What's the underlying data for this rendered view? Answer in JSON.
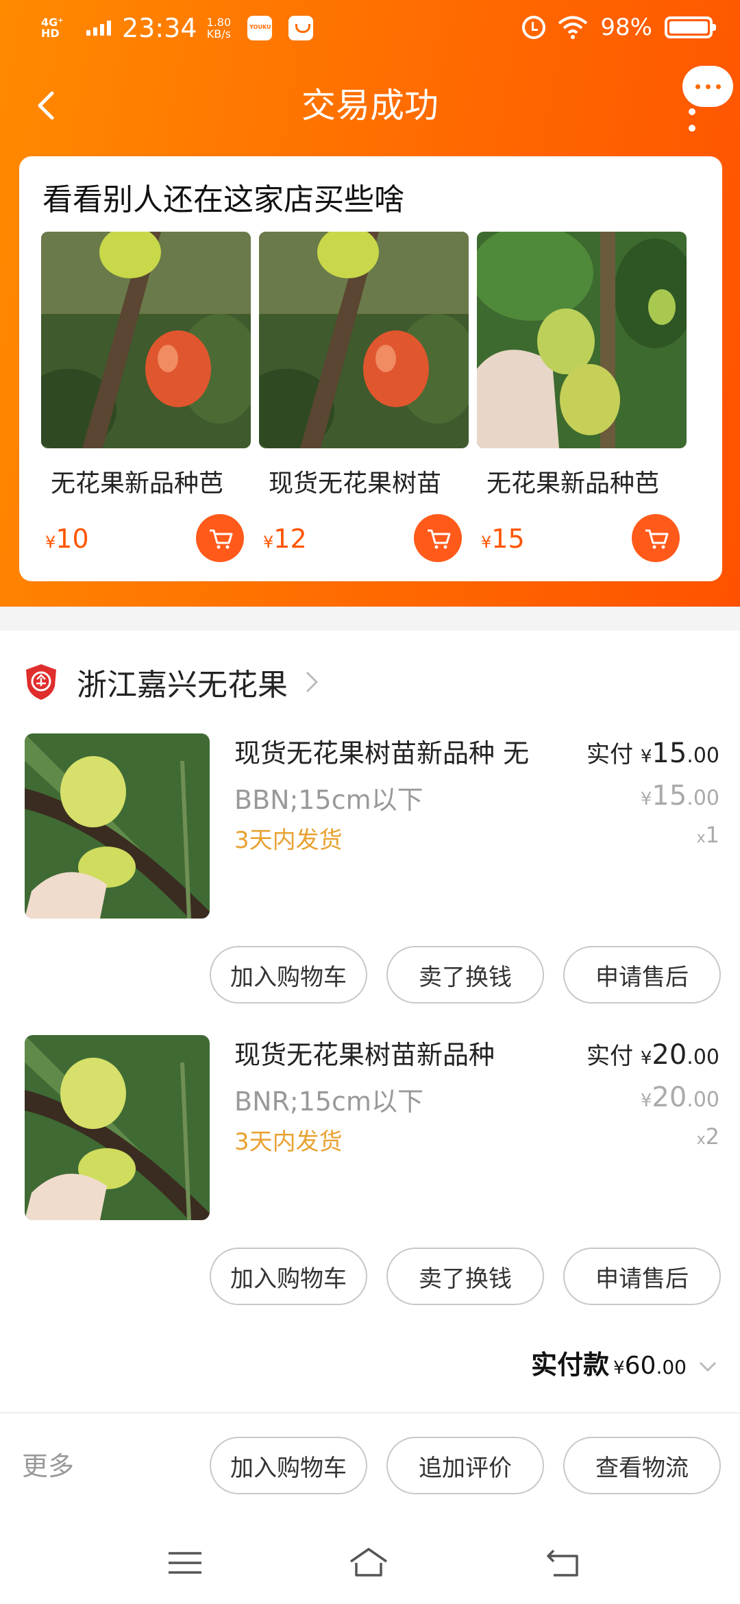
{
  "status_bar": {
    "network": "4G⁺ HD",
    "time": "23:34",
    "speed_value": "1.80",
    "speed_unit": "KB/s",
    "battery": "98%"
  },
  "header": {
    "title": "交易成功"
  },
  "recommend": {
    "title": "看看别人还在这家店买些啥",
    "items": [
      {
        "name": "无花果新品种芭",
        "currency": "¥",
        "price": "10"
      },
      {
        "name": "现货无花果树苗",
        "currency": "¥",
        "price": "12"
      },
      {
        "name": "无花果新品种芭",
        "currency": "¥",
        "price": "15"
      }
    ]
  },
  "shop": {
    "name": "浙江嘉兴无花果"
  },
  "order_items": [
    {
      "title": "现货无花果树苗新品种 无",
      "sku": "BBN;15cm以下",
      "shipping": "3天内发货",
      "paid_label": "实付",
      "currency": "¥",
      "paid_int": "15",
      "paid_dec": ".00",
      "orig_int": "15",
      "orig_dec": ".00",
      "qty_prefix": "x",
      "qty": "1",
      "buttons": [
        "加入购物车",
        "卖了换钱",
        "申请售后"
      ]
    },
    {
      "title": "现货无花果树苗新品种",
      "sku": "BNR;15cm以下",
      "shipping": "3天内发货",
      "paid_label": "实付",
      "currency": "¥",
      "paid_int": "20",
      "paid_dec": ".00",
      "orig_int": "20",
      "orig_dec": ".00",
      "qty_prefix": "x",
      "qty": "2",
      "buttons": [
        "加入购物车",
        "卖了换钱",
        "申请售后"
      ]
    }
  ],
  "total": {
    "label": "实付款",
    "currency": "¥",
    "amount_int": "60",
    "amount_dec": ".00"
  },
  "action_bar": {
    "more": "更多",
    "buttons": [
      "加入购物车",
      "追加评价",
      "查看物流"
    ]
  },
  "colors": {
    "brand_orange": "#ff6a00",
    "price_orange": "#ff5500",
    "shipping_gold": "#e8a232"
  }
}
